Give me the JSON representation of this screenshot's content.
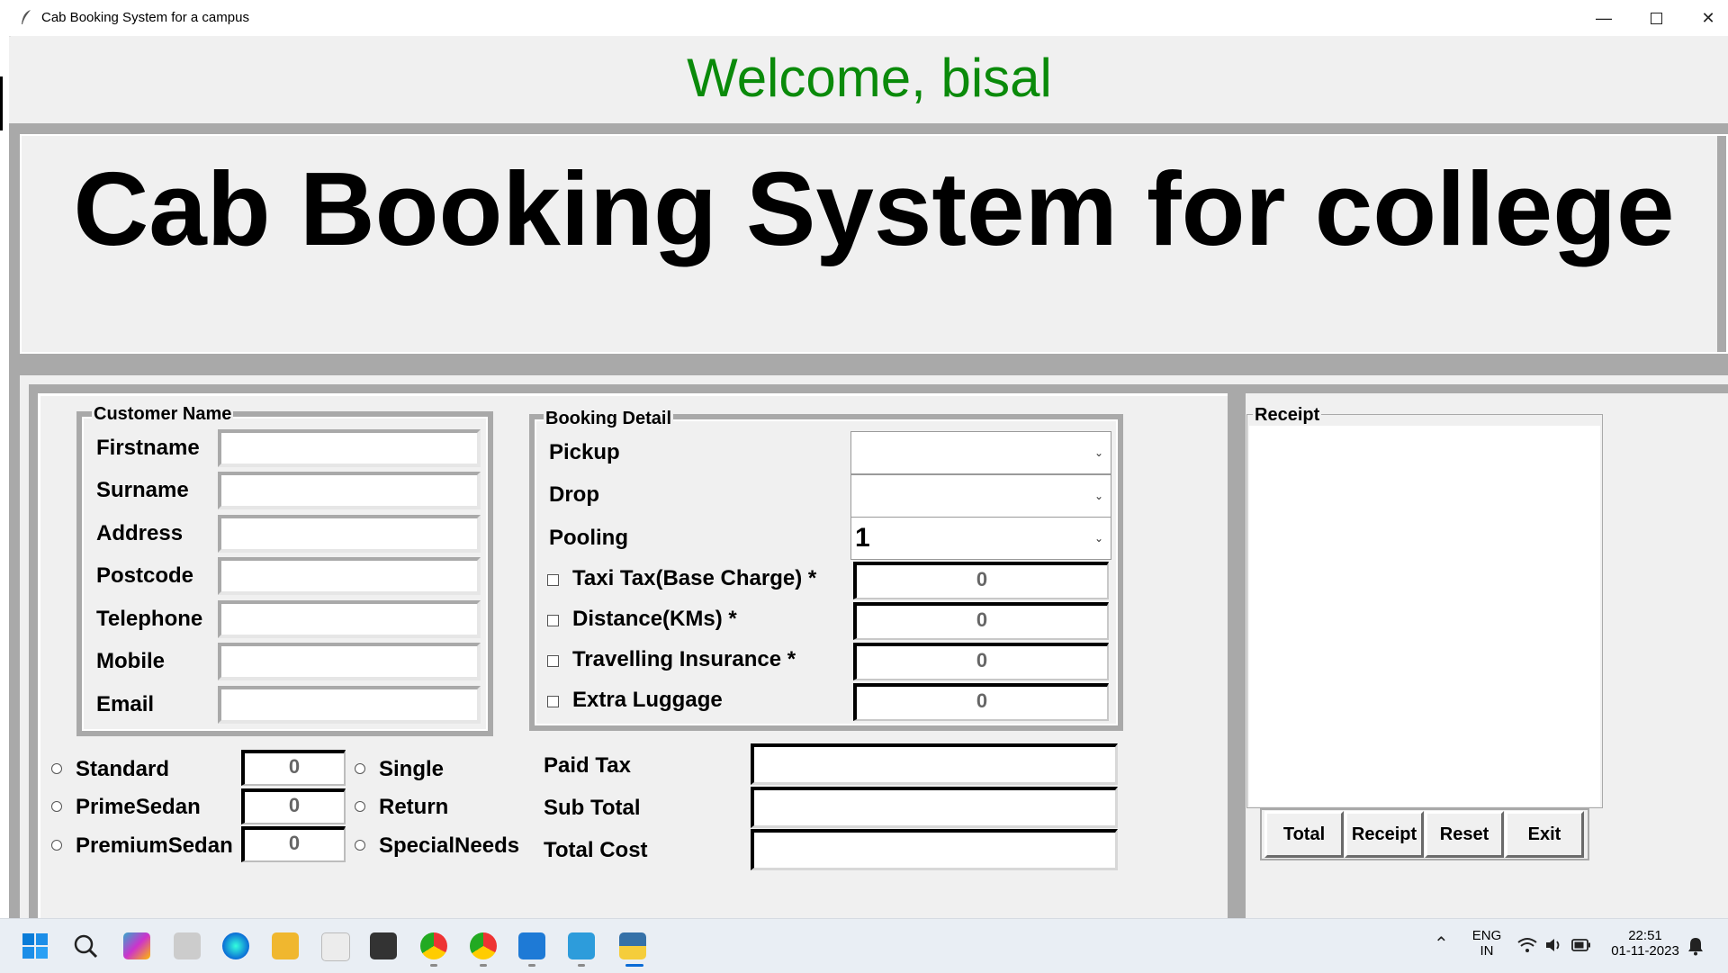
{
  "window": {
    "title": "Cab Booking System for a campus"
  },
  "welcome": "Welcome, bisal",
  "heading": "Cab Booking System for college",
  "customer": {
    "frame_title": "Customer Name",
    "labels": [
      "Firstname",
      "Surname",
      "Address",
      "Postcode",
      "Telephone",
      "Mobile",
      "Email"
    ],
    "values": [
      "",
      "",
      "",
      "",
      "",
      "",
      ""
    ]
  },
  "booking": {
    "frame_title": "Booking Detail",
    "pickup_label": "Pickup",
    "pickup_value": "",
    "drop_label": "Drop",
    "drop_value": "",
    "pooling_label": "Pooling",
    "pooling_value": "1",
    "charges": [
      {
        "label": "Taxi Tax(Base Charge) *",
        "value": "0"
      },
      {
        "label": "Distance(KMs) *",
        "value": "0"
      },
      {
        "label": "Travelling Insurance *",
        "value": "0"
      },
      {
        "label": "Extra Luggage",
        "value": "0"
      }
    ]
  },
  "car_types": [
    {
      "label": "Standard",
      "value": "0"
    },
    {
      "label": "PrimeSedan",
      "value": "0"
    },
    {
      "label": "PremiumSedan",
      "value": "0"
    }
  ],
  "trip_types": [
    "Single",
    "Return",
    "SpecialNeeds"
  ],
  "totals": {
    "paid_tax_label": "Paid Tax",
    "sub_total_label": "Sub Total",
    "total_cost_label": "Total Cost",
    "paid_tax": "",
    "sub_total": "",
    "total_cost": ""
  },
  "receipt": {
    "frame_title": "Receipt",
    "content": "",
    "buttons": [
      "Total",
      "Receipt",
      "Reset",
      "Exit"
    ]
  },
  "taskbar": {
    "language": "ENG",
    "region": "IN",
    "time": "22:51",
    "date": "01-11-2023"
  },
  "colors": {
    "welcome": "#0a8a0a",
    "frame": "#a9a9a9",
    "taskbar": "#e9eef4"
  }
}
